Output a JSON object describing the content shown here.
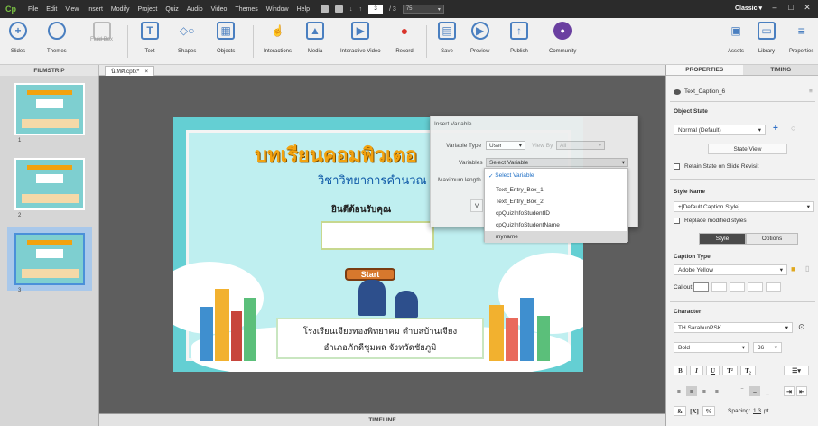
{
  "menubar": {
    "logo": "Cp",
    "items": [
      "File",
      "Edit",
      "View",
      "Insert",
      "Modify",
      "Project",
      "Quiz",
      "Audio",
      "Video",
      "Themes",
      "Window",
      "Help"
    ],
    "current_slide": "3",
    "slide_sep": "/ 3",
    "zoom": "75",
    "workspace": "Classic",
    "minimize": "–",
    "maximize": "□",
    "close": "✕"
  },
  "toolbar": {
    "slides": "Slides",
    "themes": "Themes",
    "fluid_box": "Fluid Box",
    "text": "Text",
    "shapes": "Shapes",
    "objects": "Objects",
    "interactions": "Interactions",
    "media": "Media",
    "interactive_video": "Interactive Video",
    "record": "Record",
    "save": "Save",
    "preview": "Preview",
    "publish": "Publish",
    "community": "Community",
    "assets": "Assets",
    "library": "Library",
    "properties": "Properties"
  },
  "filmstrip": {
    "header": "FILMSTRIP",
    "slides": [
      "1",
      "2",
      "3"
    ]
  },
  "tabs": {
    "doc": "นิเทศ.cptx*",
    "close": "×"
  },
  "slide": {
    "title": "บทเรียนคอมพิวเตอ",
    "subtitle": "วิชาวิทยาการคำนวณ",
    "welcome": "ยินดีต้อนรับคุณ",
    "start": "Start",
    "school_line1": "โรงเรียนเจียงทองพิทยาคม ตำบลบ้านเจียง",
    "school_line2": "อำเภอภักดีชุมพล จังหวัดชัยภูมิ"
  },
  "dialog": {
    "title": "Insert Variable",
    "variable_type_label": "Variable Type",
    "variable_type_value": "User",
    "view_by_label": "View By",
    "view_by_value": "All",
    "variables_label": "Variables",
    "variables_value": "Select Variable",
    "max_length_label": "Maximum length",
    "ok_partial": "V"
  },
  "dropdown": {
    "items": [
      "Select Variable",
      "Text_Entry_Box_1",
      "Text_Entry_Box_2",
      "cpQuizInfoStudentID",
      "cpQuizInfoStudentName",
      "myname"
    ]
  },
  "timeline": {
    "label": "TIMELINE"
  },
  "properties": {
    "tab_properties": "PROPERTIES",
    "tab_timing": "TIMING",
    "object_name": "Text_Caption_6",
    "object_state_label": "Object State",
    "object_state_value": "Normal (Default)",
    "state_view": "State View",
    "retain_state": "Retain State on Slide Revisit",
    "style_name_label": "Style Name",
    "style_name_value": "+[Default Caption Style]",
    "replace_styles": "Replace modified styles",
    "style_tab": "Style",
    "options_tab": "Options",
    "caption_type_label": "Caption Type",
    "caption_type_value": "Adobe Yellow",
    "callout_label": "Callout:",
    "character_label": "Character",
    "font_value": "TH SarabunPSK",
    "weight_value": "Bold",
    "size_value": "36",
    "bold": "B",
    "italic": "I",
    "underline": "U",
    "superscript": "T²",
    "subscript": "T₂",
    "spacing_label": "Spacing:",
    "spacing_value": "1.3",
    "spacing_unit": "pt"
  },
  "colors": {
    "accent": "#7ac143",
    "slide_bg": "#64cfd3",
    "title": "#f2a20f",
    "subtitle": "#0f5aa8",
    "start_btn": "#d7782d"
  }
}
